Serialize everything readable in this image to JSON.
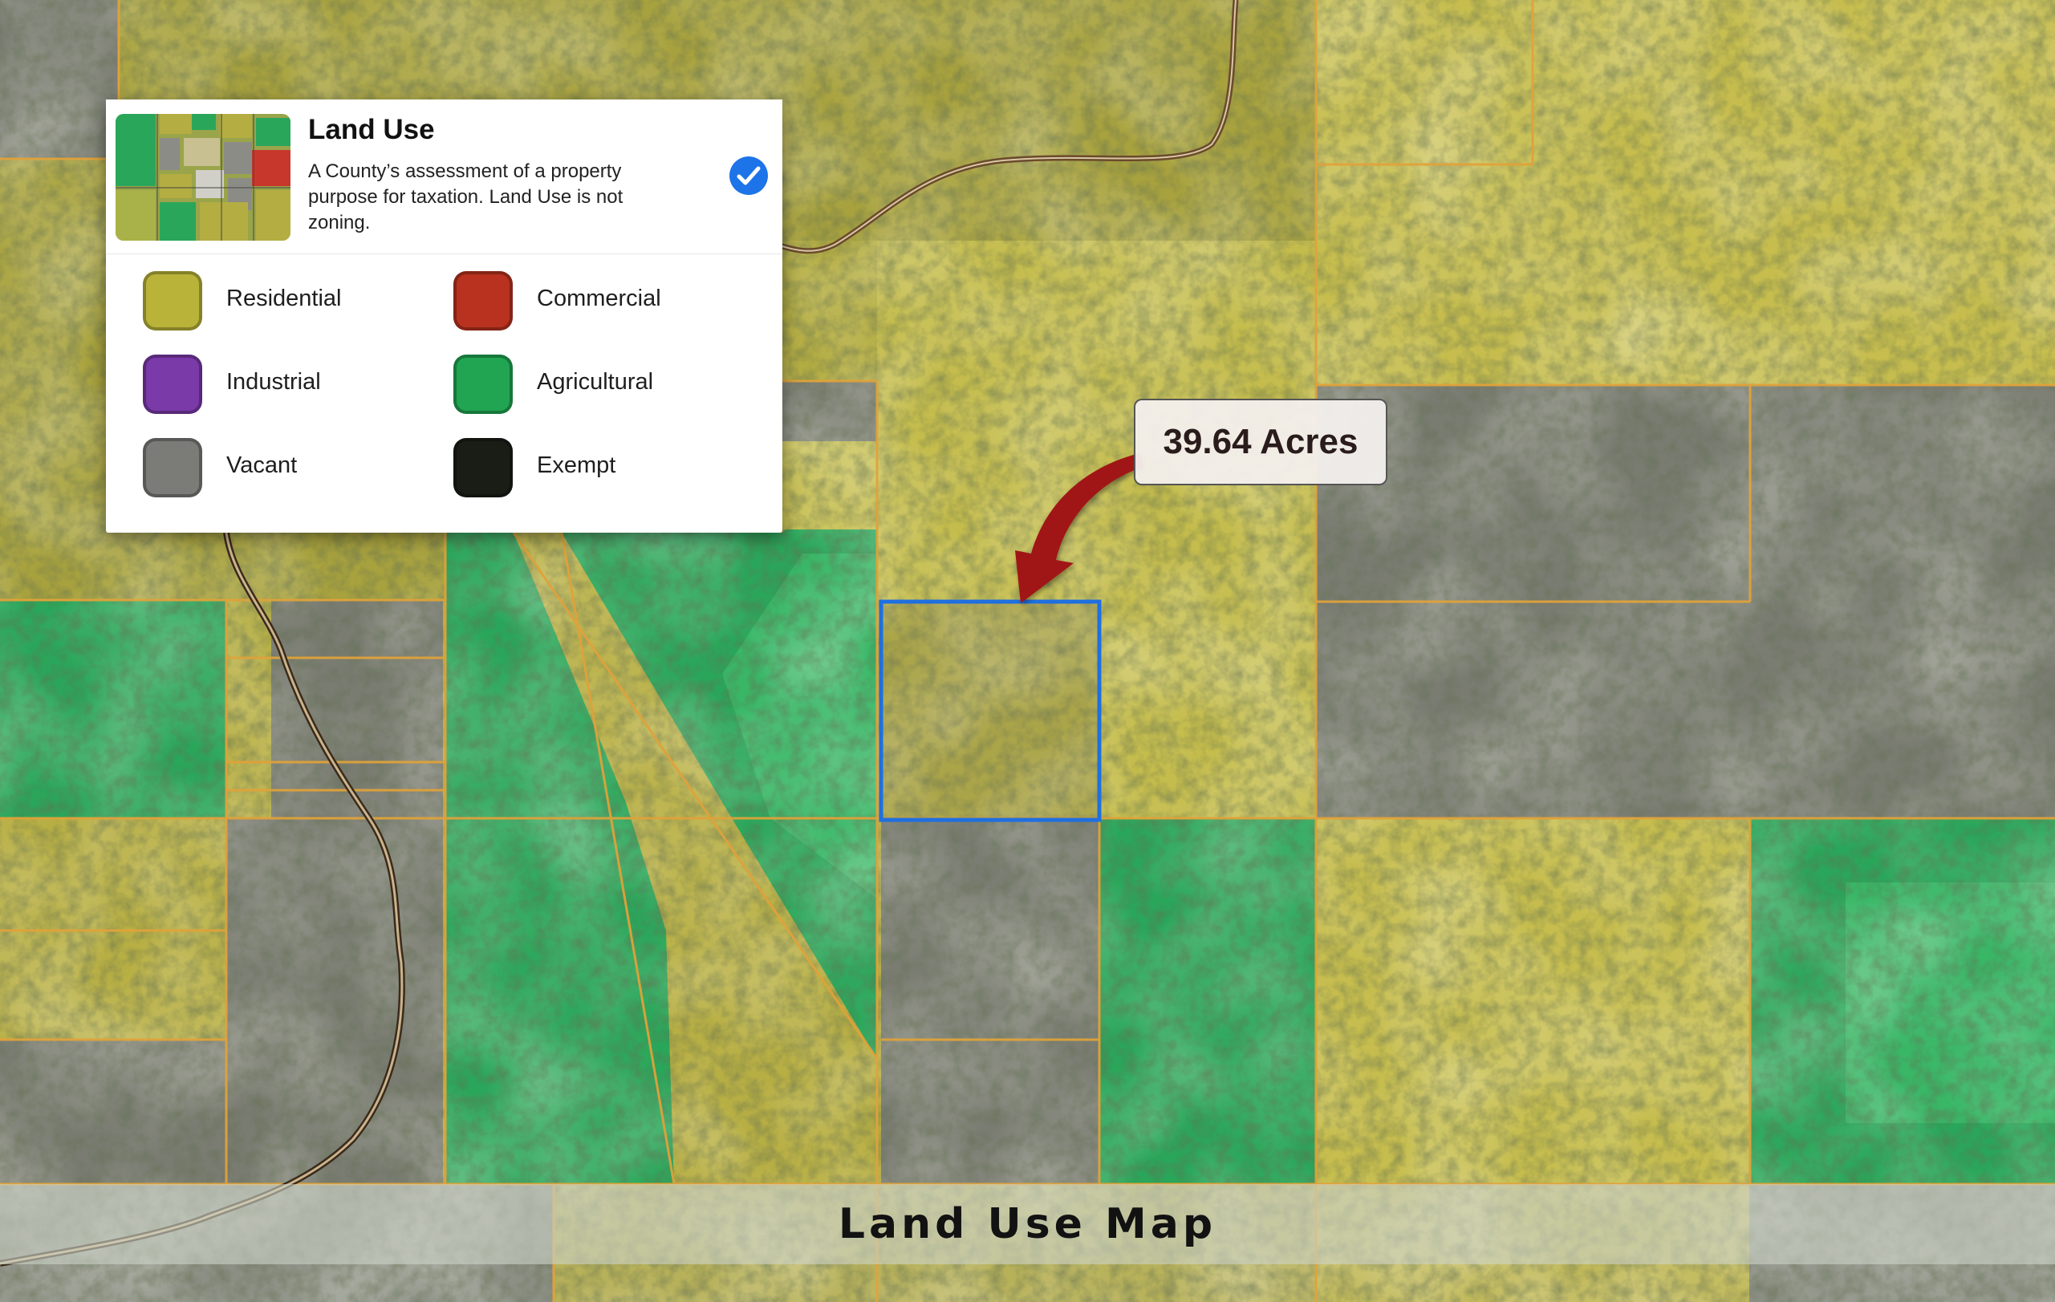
{
  "legend": {
    "title": "Land Use",
    "description": "A County’s assessment of a property purpose for taxation. Land Use is not zoning.",
    "checked": true,
    "check_icon": "checkmark-circle-icon",
    "items": [
      {
        "label": "Residential",
        "color": "#b9b33a"
      },
      {
        "label": "Commercial",
        "color": "#b8321f"
      },
      {
        "label": "Industrial",
        "color": "#7a3aa8"
      },
      {
        "label": "Agricultural",
        "color": "#21a552"
      },
      {
        "label": "Vacant",
        "color": "#7b7b78"
      },
      {
        "label": "Exempt",
        "color": "#1a1c16"
      }
    ]
  },
  "callout": {
    "text": "39.64 Acres",
    "arrow_color": "#a01818",
    "highlight_color": "#1f6fe0"
  },
  "caption": {
    "text": "Land Use Map"
  },
  "map": {
    "parcel_border_color": "#e0a23a",
    "road_color": "#6b4a2c"
  }
}
